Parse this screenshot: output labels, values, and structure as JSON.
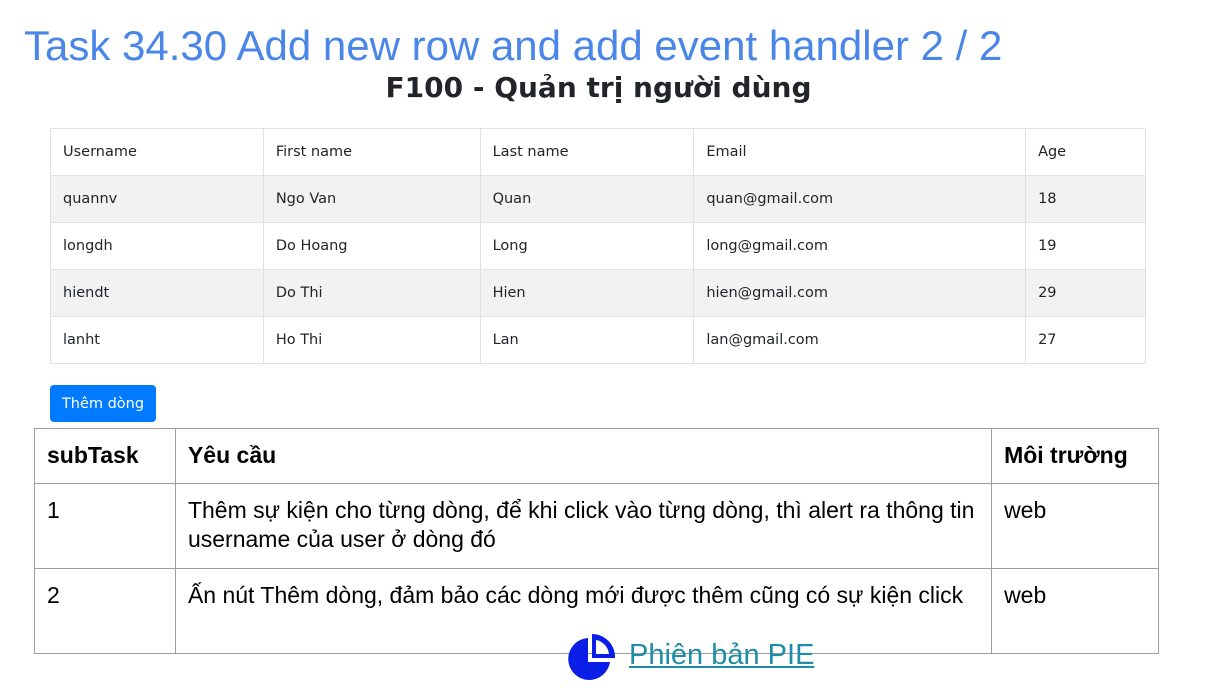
{
  "slide": {
    "title": "Task 34.30 Add new row and add event handler 2 / 2"
  },
  "app": {
    "title": "F100 - Quản trị người dùng",
    "table": {
      "headers": [
        "Username",
        "First name",
        "Last name",
        "Email",
        "Age"
      ],
      "rows": [
        [
          "quannv",
          "Ngo Van",
          "Quan",
          "quan@gmail.com",
          "18"
        ],
        [
          "longdh",
          "Do Hoang",
          "Long",
          "long@gmail.com",
          "19"
        ],
        [
          "hiendt",
          "Do Thi",
          "Hien",
          "hien@gmail.com",
          "29"
        ],
        [
          "lanht",
          "Ho Thi",
          "Lan",
          "lan@gmail.com",
          "27"
        ]
      ]
    },
    "add_button_label": "Thêm dòng",
    "accent_color": "#007bff"
  },
  "tasks": {
    "headers": [
      "subTask",
      "Yêu cầu",
      "Môi trường"
    ],
    "rows": [
      [
        "1",
        "Thêm sự kiện cho từng dòng, để khi click vào từng dòng, thì alert ra thông tin username của user ở dòng đó",
        "web"
      ],
      [
        "2",
        "Ấn nút Thêm dòng, đảm bảo các dòng mới được thêm cũng có sự kiện click",
        "web"
      ]
    ]
  },
  "footer": {
    "link_text": "Phiên bản PIE",
    "logo_icon": "pie-chart-logo-icon",
    "link_color": "#1e8ea8",
    "title_color": "#4a86e8"
  }
}
